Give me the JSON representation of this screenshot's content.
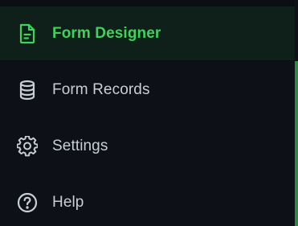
{
  "sidebar": {
    "items": [
      {
        "label": "Form Designer",
        "icon": "form-document-icon",
        "active": true
      },
      {
        "label": "Form Records",
        "icon": "database-icon",
        "active": false
      },
      {
        "label": "Settings",
        "icon": "gear-icon",
        "active": false
      },
      {
        "label": "Help",
        "icon": "question-circle-icon",
        "active": false
      }
    ]
  },
  "colors": {
    "background": "#0d1016",
    "active_background": "#0f1f19",
    "accent": "#3ed35a",
    "text": "#c9ced6",
    "scrollbar": "#2e8a43"
  }
}
